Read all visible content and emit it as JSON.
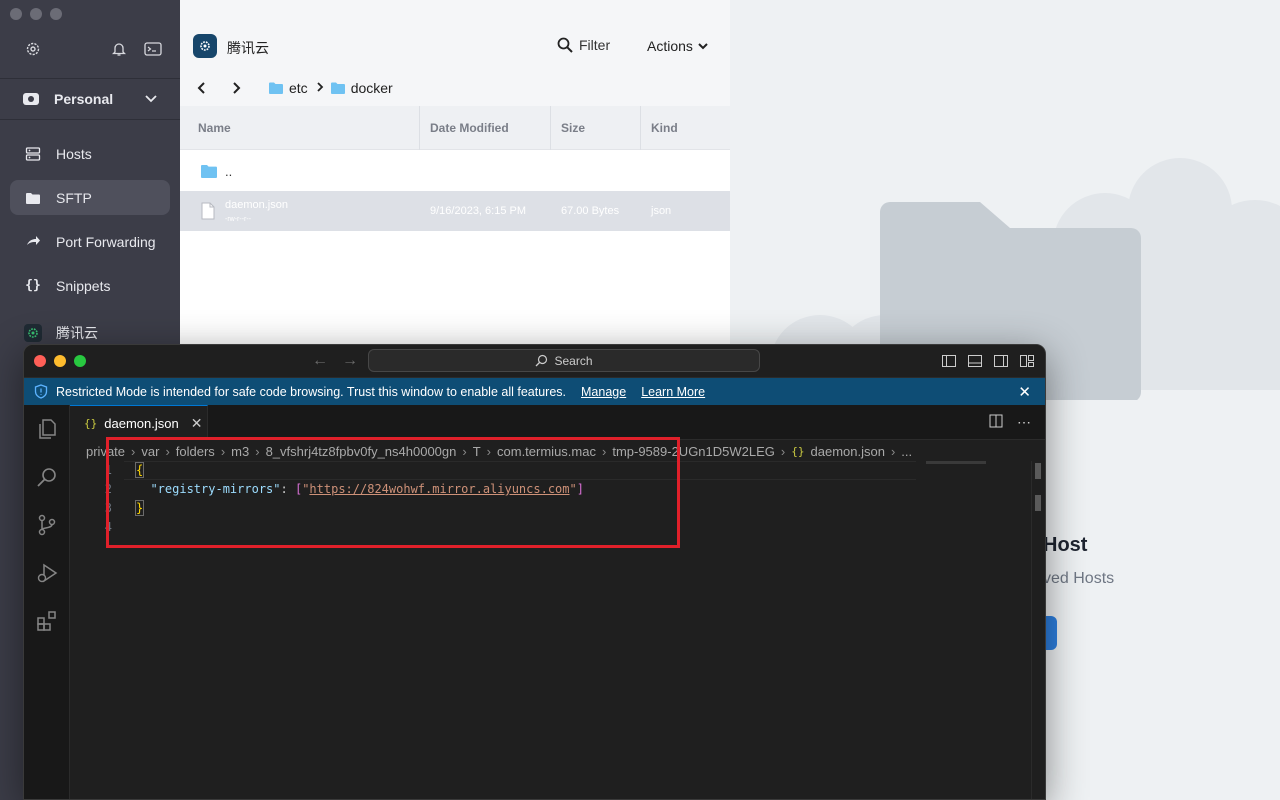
{
  "sidebar": {
    "vault": "Personal",
    "items": [
      {
        "label": "Hosts",
        "icon": "hosts-icon"
      },
      {
        "label": "SFTP",
        "icon": "folder-icon"
      },
      {
        "label": "Port Forwarding",
        "icon": "port-forward-icon"
      },
      {
        "label": "Snippets",
        "icon": "snippets-icon"
      },
      {
        "label": "腾讯云",
        "icon": "host-icon"
      }
    ]
  },
  "sftp": {
    "host_title": "腾讯云",
    "filter_label": "Filter",
    "actions_label": "Actions",
    "path": [
      "etc",
      "docker"
    ],
    "columns": [
      "Name",
      "Date Modified",
      "Size",
      "Kind"
    ],
    "rows": [
      {
        "name": "..",
        "perms": "",
        "date": "",
        "size": "",
        "kind": ""
      },
      {
        "name": "daemon.json",
        "perms": "-rw-r--r--",
        "date": "9/16/2023, 6:15 PM",
        "size": "67.00 Bytes",
        "kind": "json"
      }
    ]
  },
  "right_pane": {
    "title": "Host",
    "subtitle": "ved Hosts"
  },
  "vscode": {
    "search_label": "Search",
    "banner": {
      "message": "Restricted Mode is intended for safe code browsing. Trust this window to enable all features.",
      "manage": "Manage",
      "learn_more": "Learn More"
    },
    "tab": {
      "brace": "{}",
      "name": "daemon.json"
    },
    "breadcrumb": [
      "private",
      "var",
      "folders",
      "m3",
      "8_vfshrj4tz8fpbv0fy_ns4h0000gn",
      "T",
      "com.termius.mac",
      "tmp-9589-2UGn1D5W2LEG"
    ],
    "breadcrumb_file": "daemon.json",
    "breadcrumb_more": "...",
    "line_numbers": [
      "1",
      "2",
      "3",
      "4"
    ],
    "code": {
      "open_brace": "{",
      "key": "\"registry-mirrors\"",
      "colon": ": ",
      "lbracket": "[",
      "quote_open": "\"",
      "url": "https://824wohwf.mirror.aliyuncs.com",
      "quote_close": "\"",
      "rbracket": "]",
      "close_brace": "}"
    }
  },
  "colors": {
    "sidebar_bg": "#3c3d48",
    "banner_bg": "#0e4d75",
    "highlight": "#e0202a"
  }
}
